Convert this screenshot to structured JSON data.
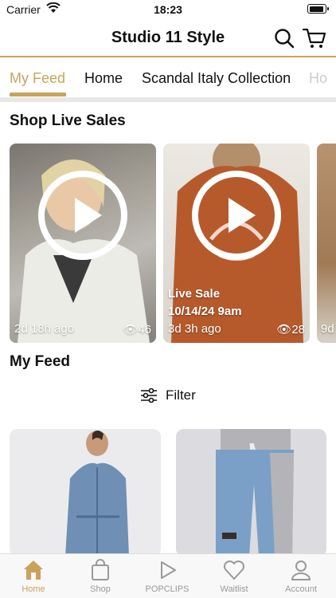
{
  "status": {
    "carrier": "Carrier",
    "time": "18:23"
  },
  "header": {
    "title": "Studio 11 Style"
  },
  "tabs": [
    {
      "label": "My Feed",
      "active": true
    },
    {
      "label": "Home"
    },
    {
      "label": "Scandal Italy Collection"
    },
    {
      "label": "Ho"
    }
  ],
  "live_sales": {
    "title": "Shop Live Sales",
    "cards": [
      {
        "time_ago": "2d 18h ago",
        "views": "46"
      },
      {
        "label": "Live Sale",
        "date": "10/14/24 9am",
        "time_ago": "3d 3h ago",
        "views": "28"
      },
      {
        "time_ago": "9d"
      }
    ]
  },
  "feed": {
    "title": "My Feed",
    "filter_label": "Filter"
  },
  "bottom_nav": [
    {
      "label": "Home",
      "icon": "home-icon",
      "active": true
    },
    {
      "label": "Shop",
      "icon": "shopping-bag-icon"
    },
    {
      "label": "POPCLIPS",
      "icon": "play-icon"
    },
    {
      "label": "Waitlist",
      "icon": "heart-icon"
    },
    {
      "label": "Account",
      "icon": "person-icon"
    }
  ],
  "colors": {
    "accent": "#c9a35c"
  }
}
